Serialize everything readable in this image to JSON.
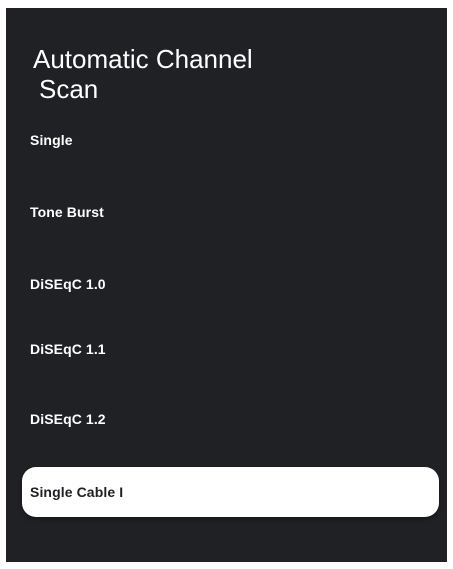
{
  "screen": {
    "title_line1": "Automatic Channel",
    "title_line2": "Scan"
  },
  "options": [
    {
      "label": "Single"
    },
    {
      "label": "Tone Burst"
    },
    {
      "label": "DiSEqC 1.0"
    },
    {
      "label": "DiSEqC 1.1"
    },
    {
      "label": "DiSEqC 1.2"
    },
    {
      "label": "Single Cable I",
      "selected": true
    }
  ],
  "colors": {
    "panel_background": "#202124",
    "text": "#ffffff",
    "selected_background": "#ffffff",
    "selected_text": "#202124"
  }
}
